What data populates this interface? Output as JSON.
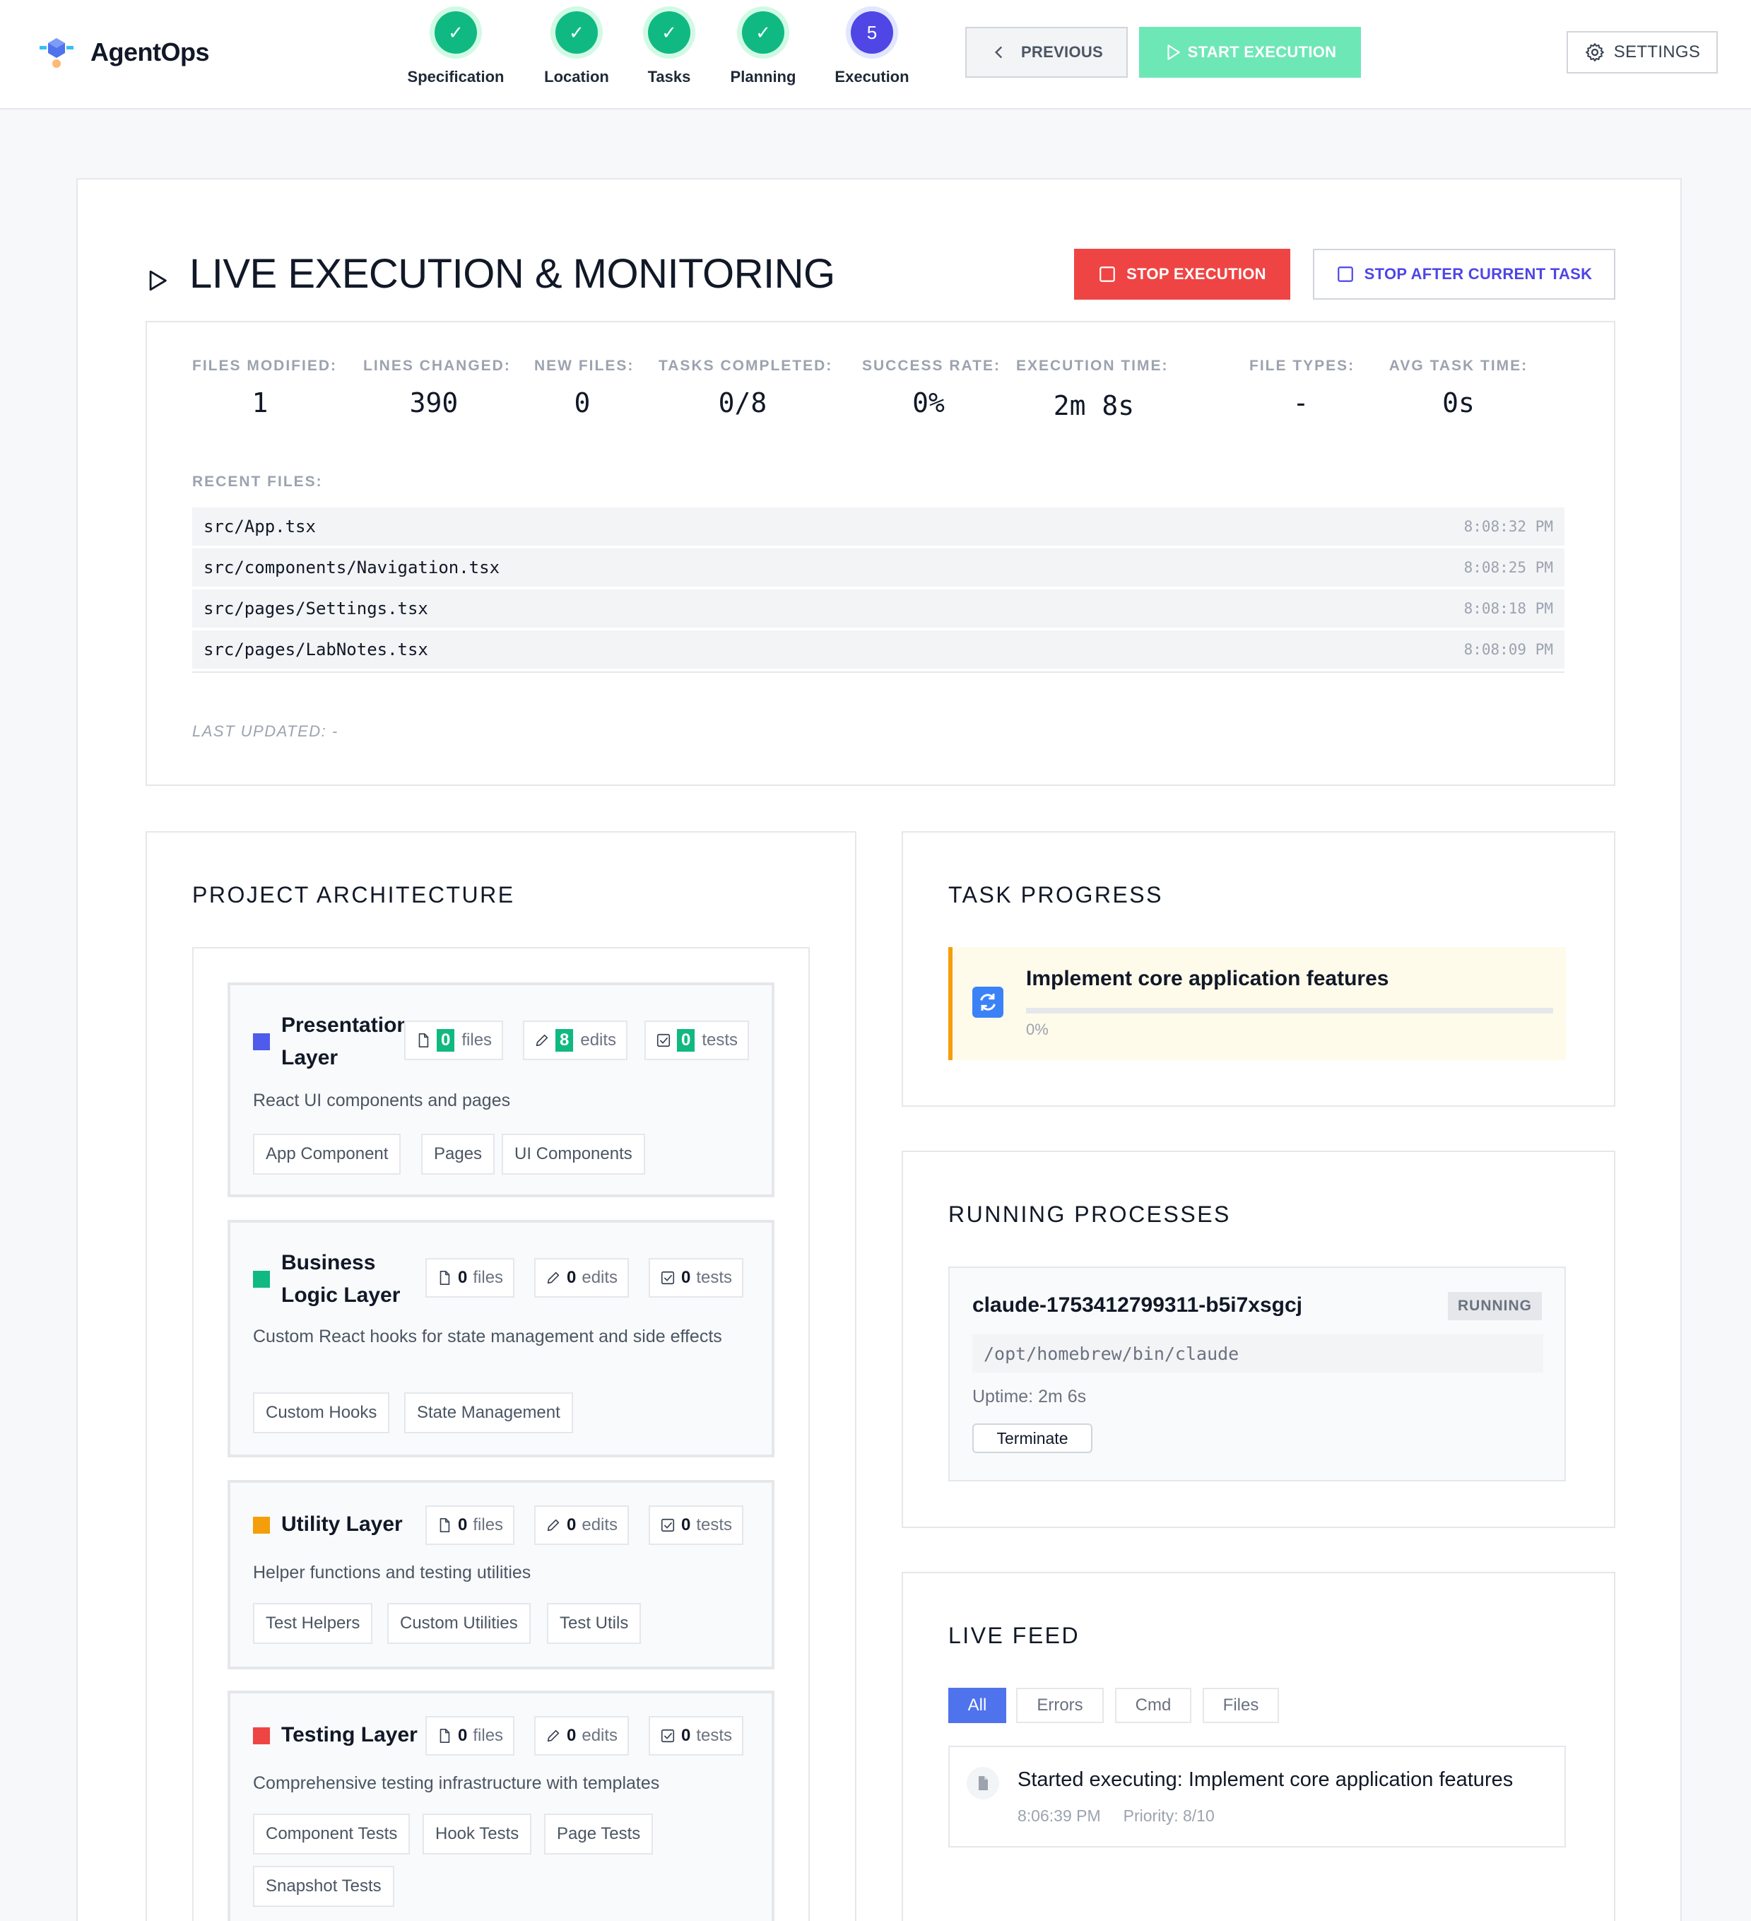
{
  "app": {
    "name": "AgentOps"
  },
  "steps": [
    {
      "label": "Specification",
      "status": "done",
      "glyph": "✓"
    },
    {
      "label": "Location",
      "status": "done",
      "glyph": "✓"
    },
    {
      "label": "Tasks",
      "status": "done",
      "glyph": "✓"
    },
    {
      "label": "Planning",
      "status": "done",
      "glyph": "✓"
    },
    {
      "label": "Execution",
      "status": "active",
      "glyph": "5"
    }
  ],
  "header": {
    "previous_label": "PREVIOUS",
    "start_label": "START EXECUTION",
    "settings_label": "SETTINGS"
  },
  "page": {
    "title": "LIVE EXECUTION & MONITORING",
    "stop_label": "STOP EXECUTION",
    "stop_after_label": "STOP AFTER CURRENT TASK"
  },
  "metrics": [
    {
      "label": "FILES MODIFIED:",
      "value": "1"
    },
    {
      "label": "LINES CHANGED:",
      "value": "390"
    },
    {
      "label": "NEW FILES:",
      "value": "0"
    },
    {
      "label": "TASKS COMPLETED:",
      "value": "0/8"
    },
    {
      "label": "SUCCESS RATE:",
      "value": "0%"
    },
    {
      "label": "EXECUTION TIME:",
      "value": "2m 8s"
    },
    {
      "label": "FILE TYPES:",
      "value": "-"
    },
    {
      "label": "AVG TASK TIME:",
      "value": "0s"
    }
  ],
  "recent": {
    "label": "RECENT FILES:",
    "files": [
      {
        "path": "src/App.tsx",
        "time": "8:08:32 PM"
      },
      {
        "path": "src/components/Navigation.tsx",
        "time": "8:08:25 PM"
      },
      {
        "path": "src/pages/Settings.tsx",
        "time": "8:08:18 PM"
      },
      {
        "path": "src/pages/LabNotes.tsx",
        "time": "8:08:09 PM"
      }
    ],
    "last_updated": "LAST UPDATED: -"
  },
  "architecture": {
    "title": "PROJECT ARCHITECTURE",
    "unit_files": "files",
    "unit_edits": "edits",
    "unit_tests": "tests",
    "layers": [
      {
        "name_line1": "Presentation",
        "name_line2": "Layer",
        "color": "#4f5bea",
        "files": "0",
        "edits": "8",
        "tests": "0",
        "description": "React UI components and pages",
        "tags": [
          "App Component",
          "Pages",
          "UI Components"
        ]
      },
      {
        "name_line1": "Business",
        "name_line2": "Logic Layer",
        "color": "#10b981",
        "files": "0",
        "edits": "0",
        "tests": "0",
        "description": "Custom React hooks for state management and side effects",
        "tags": [
          "Custom Hooks",
          "State Management"
        ]
      },
      {
        "name_line1": "Utility Layer",
        "name_line2": "",
        "color": "#f59e0b",
        "files": "0",
        "edits": "0",
        "tests": "0",
        "description": "Helper functions and testing utilities",
        "tags": [
          "Test Helpers",
          "Custom Utilities",
          "Test Utils"
        ]
      },
      {
        "name_line1": "Testing Layer",
        "name_line2": "",
        "color": "#ef4444",
        "files": "0",
        "edits": "0",
        "tests": "0",
        "description": "Comprehensive testing infrastructure with templates",
        "tags": [
          "Component Tests",
          "Hook Tests",
          "Page Tests",
          "Snapshot Tests"
        ]
      }
    ]
  },
  "task_progress": {
    "title": "TASK PROGRESS",
    "task_name": "Implement core application features",
    "progress": 0,
    "progress_label": "0%"
  },
  "processes": {
    "title": "RUNNING PROCESSES",
    "items": [
      {
        "name": "claude-1753412799311-b5i7xsgcj",
        "status": "RUNNING",
        "path": "/opt/homebrew/bin/claude",
        "uptime": "Uptime: 2m 6s",
        "terminate_label": "Terminate"
      }
    ]
  },
  "feed": {
    "title": "LIVE FEED",
    "tabs": [
      "All",
      "Errors",
      "Cmd",
      "Files"
    ],
    "active_tab": "All",
    "entries": [
      {
        "text": "Started executing: Implement core application features",
        "time": "8:06:39 PM",
        "priority": "Priority: 8/10"
      }
    ]
  },
  "colors": {
    "accent": "#4f46e5",
    "success": "#10b981",
    "danger": "#ef4444",
    "warning": "#f59e0b"
  }
}
